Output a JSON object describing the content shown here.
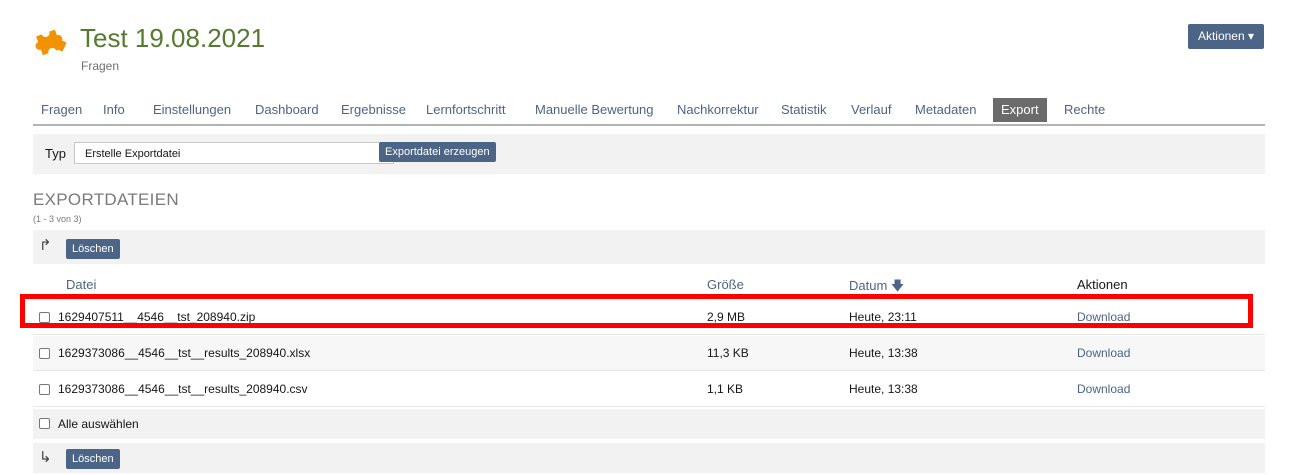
{
  "header": {
    "title": "Test 19.08.2021",
    "subtitle": "Fragen",
    "actions_label": "Aktionen ▾",
    "logo_icon": "puzzle-icon",
    "logo_color": "#f39200"
  },
  "tabs": [
    "Fragen",
    "Info",
    "Einstellungen",
    "Dashboard",
    "Ergebnisse",
    "Lernfortschritt",
    "Manuelle Bewertung",
    "Nachkorrektur",
    "Statistik",
    "Verlauf",
    "Metadaten",
    "Export",
    "Rechte"
  ],
  "active_tab": "Export",
  "toolbar": {
    "type_label": "Typ",
    "type_value": "Erstelle Exportdatei",
    "export_button": "Exportdatei erzeugen"
  },
  "section": {
    "title": "EXPORTDATEIEN",
    "count": "(1 - 3 von 3)"
  },
  "bulk": {
    "delete_label": "Löschen"
  },
  "columns": {
    "file": "Datei",
    "size": "Größe",
    "date": "Datum",
    "date_sort_icon": "arrow-down-icon",
    "actions": "Aktionen"
  },
  "rows": [
    {
      "file": "1629407511__4546__tst_208940.zip",
      "size": "2,9 MB",
      "date": "Heute, 23:11",
      "action": "Download"
    },
    {
      "file": "1629373086__4546__tst__results_208940.xlsx",
      "size": "11,3 KB",
      "date": "Heute, 13:38",
      "action": "Download"
    },
    {
      "file": "1629373086__4546__tst__results_208940.csv",
      "size": "1,1 KB",
      "date": "Heute, 13:38",
      "action": "Download"
    }
  ],
  "select_all_label": "Alle auswählen",
  "colors": {
    "accent": "#4c6586",
    "title": "#557b2e",
    "highlight": "#ff0000"
  }
}
